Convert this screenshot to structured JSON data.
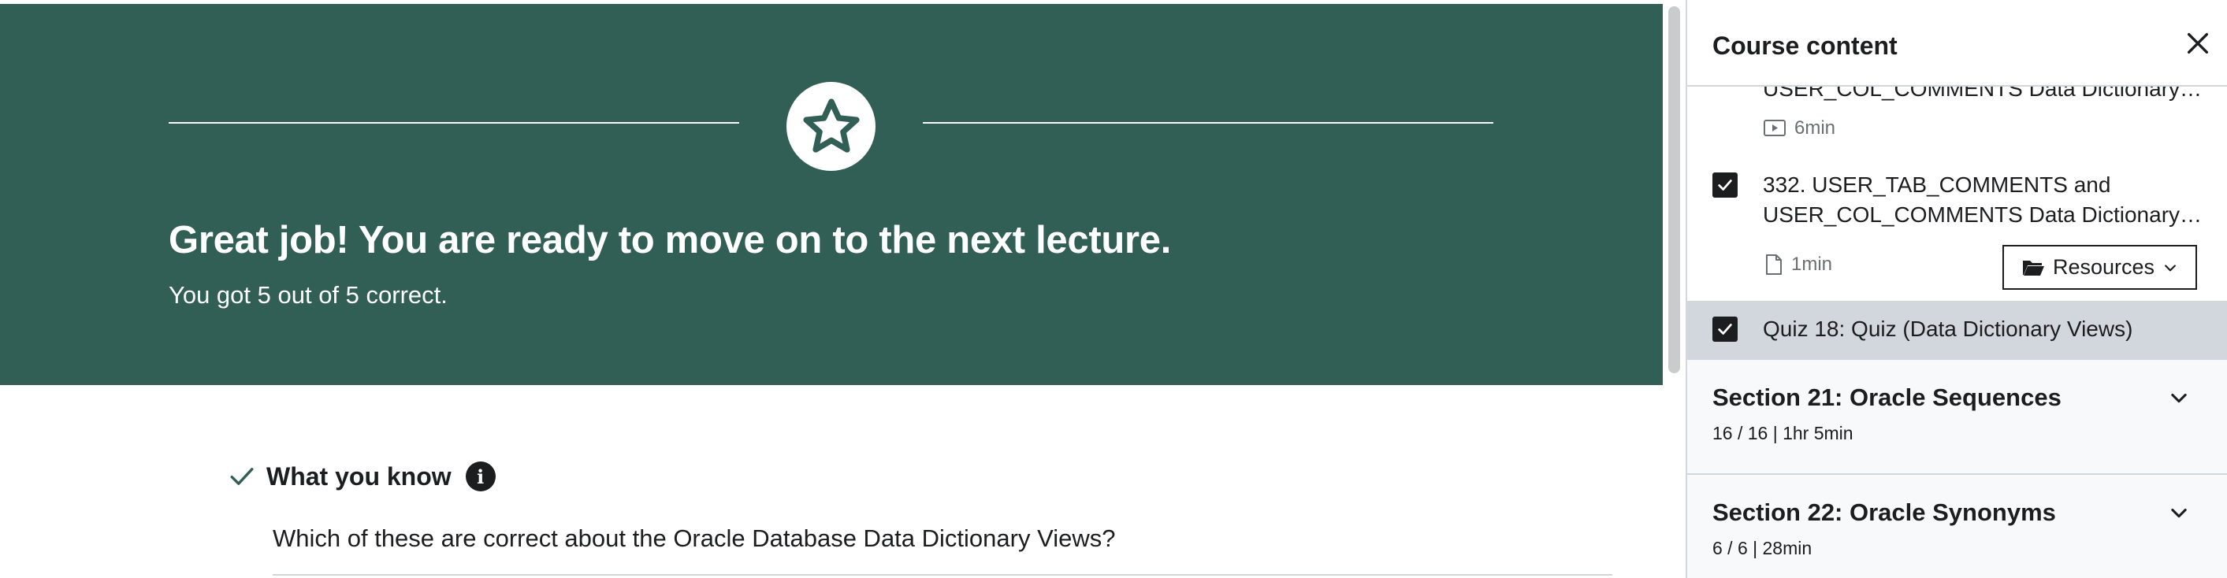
{
  "banner": {
    "title": "Great job! You are ready to move on to the next lecture.",
    "subtitle": "You got 5 out of 5 correct.",
    "color": "#325f55"
  },
  "know": {
    "title": "What you know",
    "question": "Which of these are correct about the Oracle Database Data Dictionary Views?"
  },
  "sidebar": {
    "title": "Course content",
    "items": [
      {
        "title": "USER_COL_COMMENTS Data Dictionary…",
        "type_icon": "video-icon",
        "duration": "6min"
      },
      {
        "title_line1": "332. USER_TAB_COMMENTS and",
        "title_line2": "USER_COL_COMMENTS Data Dictionary…",
        "type_icon": "file-icon",
        "duration": "1min",
        "completed": true,
        "resources_label": "Resources"
      },
      {
        "title": "Quiz 18: Quiz (Data Dictionary Views)",
        "completed": true,
        "active": true
      }
    ],
    "sections": [
      {
        "title": "Section 21: Oracle Sequences",
        "meta": "16 / 16 | 1hr 5min"
      },
      {
        "title": "Section 22: Oracle Synonyms",
        "meta": "6 / 6 | 28min"
      }
    ]
  }
}
